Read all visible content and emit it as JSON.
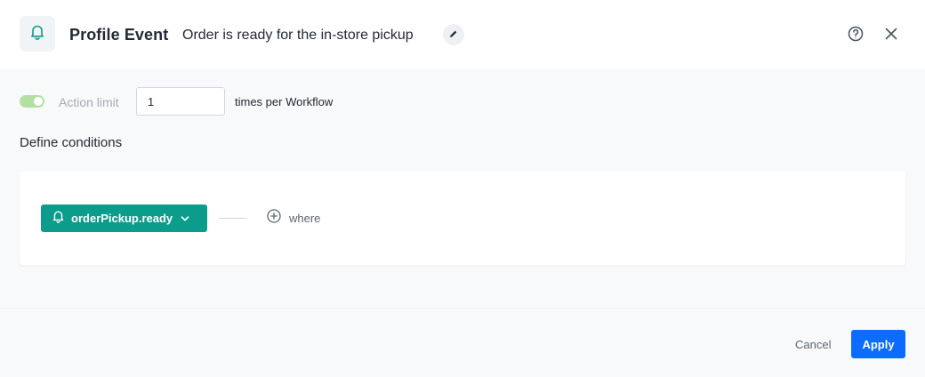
{
  "header": {
    "title": "Profile Event",
    "subtitle": "Order is ready for the in-store pickup",
    "icon": "bell-icon",
    "actions": {
      "edit_icon": "pencil-icon",
      "help_icon": "help-icon",
      "close_icon": "close-icon"
    }
  },
  "action_limit": {
    "enabled": true,
    "label": "Action limit",
    "value": "1",
    "suffix": "times per Workflow"
  },
  "conditions": {
    "title": "Define conditions",
    "event": {
      "label": "orderPickup.ready",
      "icon": "bell-icon",
      "dropdown_icon": "chevron-down-icon"
    },
    "where": {
      "label": "where",
      "icon": "plus-circle-icon"
    }
  },
  "footer": {
    "cancel_label": "Cancel",
    "apply_label": "Apply"
  },
  "colors": {
    "accent_teal": "#0b9c8c",
    "primary_blue": "#0b6cff",
    "toggle_on": "#b3e0a2"
  }
}
